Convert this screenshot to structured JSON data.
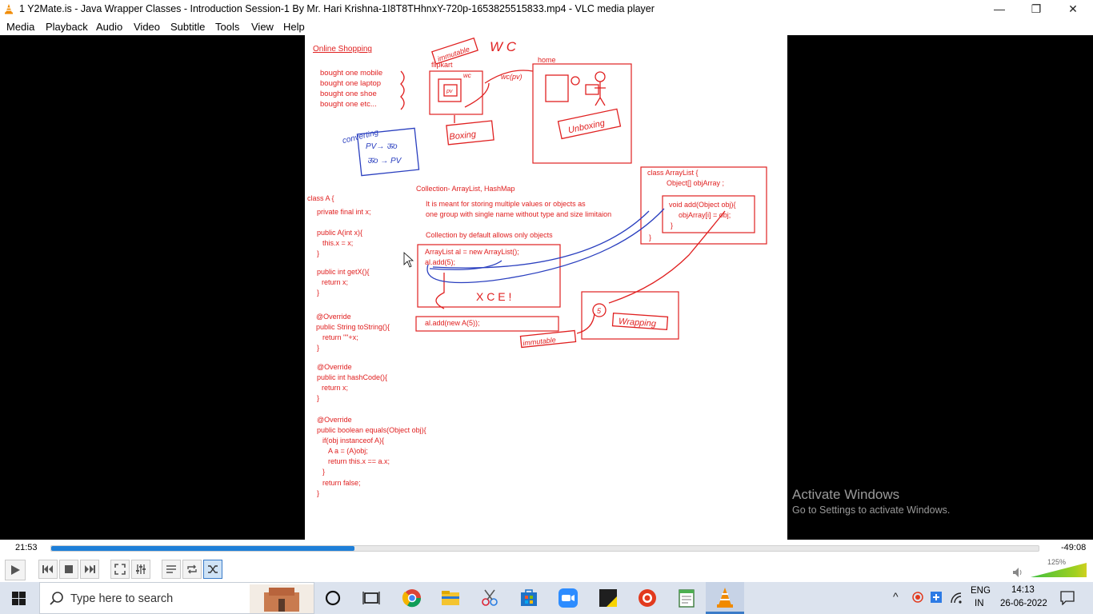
{
  "window": {
    "title": "1 Y2Mate.is - Java Wrapper Classes - Introduction  Session-1   By Mr. Hari Krishna-1I8T8THhnxY-720p-1653825515833.mp4 - VLC media player",
    "minimize_glyph": "—",
    "maximize_glyph": "❐",
    "close_glyph": "✕"
  },
  "menu": {
    "items": [
      {
        "label": "Media"
      },
      {
        "label": "Playback"
      },
      {
        "label": "Audio"
      },
      {
        "label": "Video"
      },
      {
        "label": "Subtitle"
      },
      {
        "label": "Tools"
      },
      {
        "label": "View"
      },
      {
        "label": "Help"
      }
    ]
  },
  "slide": {
    "heading": "Online Shopping",
    "bought": [
      "bought one mobile",
      "bought one laptop",
      "bought one shoe",
      "bought one etc..."
    ],
    "flipkart": "flipkart",
    "home": "home",
    "class_a_code": [
      "class A {",
      "private    final      int x;",
      "public A(int x){",
      "this.x = x;",
      "}",
      "public int getX(){",
      "return x;",
      "}",
      "@Override",
      "public String toString(){",
      "return \"\"+x;",
      "}",
      "@Override",
      "public int hashCode(){",
      "return x;",
      "}",
      "@Override",
      "public boolean equals(Object obj){",
      "if(obj instanceof A){",
      "A a = (A)obj;",
      "return this.x == a.x;",
      "}",
      "return false;",
      "}"
    ],
    "collection_title": "Collection- ArrayList, HashMap",
    "collection_desc1": "It is meant for storing multiple values or objects as",
    "collection_desc2": "one group with single name without type and size limitaion",
    "collection_default": "Collection by default allows only objects",
    "arraylist_line1": "ArrayList al = new ArrayList();",
    "arraylist_line2": "al.add(5);",
    "wrapped_add": "al.add(new A(5));",
    "arraylist_class": [
      "class ArrayList {",
      "Object[] objArray ;",
      "void add(Object obj){",
      "objArray[i] = obj;",
      "}",
      "}"
    ],
    "hand_immutable": "immutable",
    "hand_wc_title": "W C",
    "hand_wc": "wc",
    "hand_wcpv": "wc(pv)",
    "hand_pv": "pv",
    "hand_converting": "converting",
    "hand_pv_wc": "PV→ ऊo",
    "hand_wc_pv": "ऊo → PV",
    "hand_boxing": "Boxing",
    "hand_unboxing": "Unboxing",
    "hand_xce": "X C E !",
    "hand_immutable2": "immutable",
    "hand_five": "5",
    "hand_wrapping": "Wrapping"
  },
  "watermark": {
    "line1": "Activate Windows",
    "line2": "Go to Settings to activate Windows."
  },
  "player": {
    "elapsed": "21:53",
    "remaining": "-49:08",
    "progress_fraction": 0.307,
    "volume_percent": "125%"
  },
  "taskbar": {
    "search_placeholder": "Type here to search",
    "lang_top": "ENG",
    "lang_bottom": "IN",
    "time": "14:13",
    "date": "26-06-2022"
  },
  "colors": {
    "accent_blue": "#1e7fd8",
    "slide_red": "#e02020",
    "pen_blue": "#2a3fbf"
  }
}
